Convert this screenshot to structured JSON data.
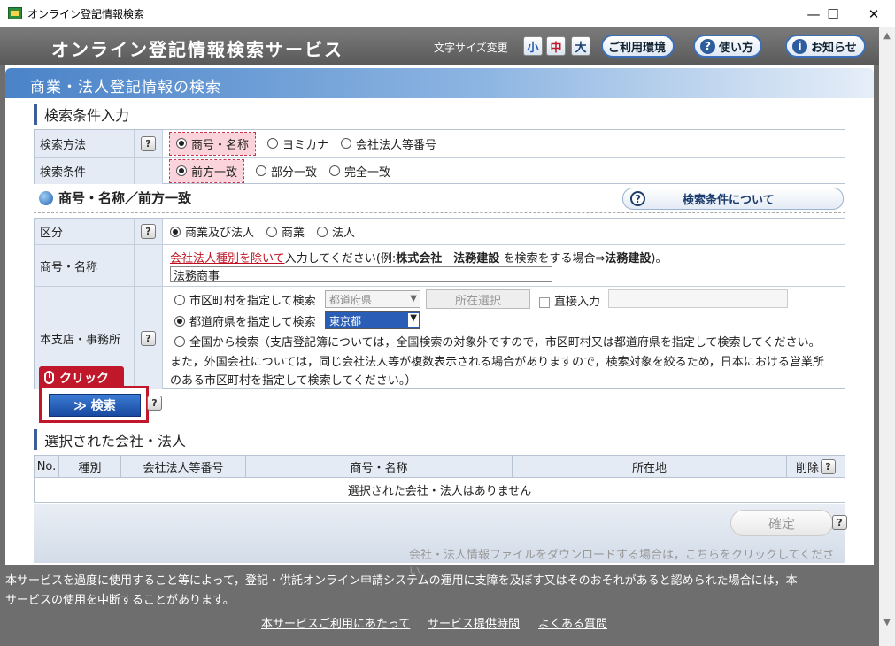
{
  "window": {
    "title": "オンライン登記情報検索",
    "minimize": "—",
    "maximize": "☐",
    "close": "✕"
  },
  "header": {
    "service_name": "オンライン登記情報検索サービス",
    "font_size_label": "文字サイズ変更",
    "font_sizes": [
      "小",
      "中",
      "大"
    ],
    "env_button": "ご利用環境",
    "howto_button": "使い方",
    "notice_button": "お知らせ"
  },
  "banner": {
    "title": "商業・法人登記情報の検索"
  },
  "search_conditions": {
    "heading": "検索条件入力",
    "method_label": "検索方法",
    "method_options": [
      "商号・名称",
      "ヨミカナ",
      "会社法人等番号"
    ],
    "condition_label": "検索条件",
    "condition_options": [
      "前方一致",
      "部分一致",
      "完全一致"
    ]
  },
  "subsection": {
    "title": "商号・名称／前方一致",
    "about_button": "検索条件について"
  },
  "detail": {
    "category_label": "区分",
    "category_options": [
      "商業及び法人",
      "商業",
      "法人"
    ],
    "name_label": "商号・名称",
    "hint_link": "会社法人種別を除いて",
    "hint_text1": "入力してください(例:",
    "hint_bold1": "株式会社　法務建設",
    "hint_text2": "を検索をする場合⇒",
    "hint_bold2": "法務建設",
    "hint_text3": ")。",
    "name_value": "法務商事",
    "office_label": "本支店・事務所",
    "opt_city": "市区町村を指定して検索",
    "prefecture_select": "都道府県",
    "location_button": "所在選択",
    "direct_input": "直接入力",
    "opt_pref": "都道府県を指定して検索",
    "pref_value": "東京都",
    "opt_all": "全国から検索（支店登記簿については，全国検索の対象外ですので，市区町村又は都道府県を指定して検索してください。",
    "note_line2": "また，外国会社については，同じ会社法人等が複数表示される場合がありますので，検索対象を絞るため，日本における営業所",
    "note_line3": "のある市区町村を指定して検索してください。）"
  },
  "search_action": {
    "click_label": "クリック",
    "search_button": "≫ 検索"
  },
  "selected": {
    "heading": "選択された会社・法人",
    "columns": [
      "No.",
      "種別",
      "会社法人等番号",
      "商号・名称",
      "所在地",
      "削除"
    ],
    "empty_message": "選択された会社・法人はありません",
    "confirm_button": "確定",
    "download_note": "会社・法人情報ファイルをダウンロードする場合は，こちらをクリックしてください。"
  },
  "footer": {
    "notice_line1": "本サービスを過度に使用すること等によって，登記・供託オンライン申請システムの運用に支障を及ぼす又はそのおそれがあると認められた場合には，本",
    "notice_line2": "サービスの使用を中断することがあります。",
    "links": [
      "本サービスご利用にあたって",
      "サービス提供時間",
      "よくある質問"
    ]
  },
  "icons": {
    "help": "?",
    "info": "i"
  }
}
